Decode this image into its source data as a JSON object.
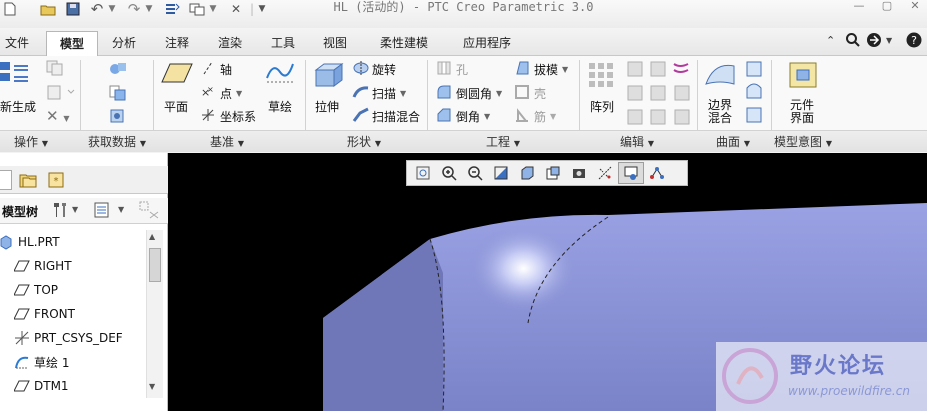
{
  "window": {
    "title": "HL (活动的) - PTC Creo Parametric 3.0"
  },
  "tabs": [
    {
      "label": "文件"
    },
    {
      "label": "模型"
    },
    {
      "label": "分析"
    },
    {
      "label": "注释"
    },
    {
      "label": "渲染"
    },
    {
      "label": "工具"
    },
    {
      "label": "视图"
    },
    {
      "label": "柔性建模"
    },
    {
      "label": "应用程序"
    }
  ],
  "ribbon": {
    "regenerate": "新生成",
    "axis": "轴",
    "point": "点",
    "csys": "坐标系",
    "plane": "平面",
    "sketch": "草绘",
    "revolve": "旋转",
    "sweep": "扫描",
    "swept_blend": "扫描混合",
    "extrude": "拉伸",
    "hole": "孔",
    "round": "倒圆角",
    "chamfer": "倒角",
    "draft": "拔模",
    "shell": "壳",
    "rib": "筋",
    "pattern": "阵列",
    "boundary_blend_l1": "边界",
    "boundary_blend_l2": "混合",
    "component_interface_l1": "元件",
    "component_interface_l2": "界面"
  },
  "groups": [
    {
      "label": "操作"
    },
    {
      "label": "获取数据"
    },
    {
      "label": "基准"
    },
    {
      "label": "形状"
    },
    {
      "label": "工程"
    },
    {
      "label": "编辑"
    },
    {
      "label": "曲面"
    },
    {
      "label": "模型意图"
    }
  ],
  "model_tree": {
    "title": "模型树",
    "items": [
      {
        "label": "HL.PRT",
        "icon": "part-icon"
      },
      {
        "label": "RIGHT",
        "icon": "datum-plane-icon"
      },
      {
        "label": "TOP",
        "icon": "datum-plane-icon"
      },
      {
        "label": "FRONT",
        "icon": "datum-plane-icon"
      },
      {
        "label": "PRT_CSYS_DEF",
        "icon": "csys-icon"
      },
      {
        "label": "草绘 1",
        "icon": "sketch-icon"
      },
      {
        "label": "DTM1",
        "icon": "datum-plane-icon"
      }
    ]
  },
  "watermark": {
    "text": "野火论坛",
    "url": "www.proewildfire.cn"
  },
  "colors": {
    "model_fill": "#7f88cc",
    "viewport_bg": "#000000",
    "accent": "#3a6fb8"
  }
}
